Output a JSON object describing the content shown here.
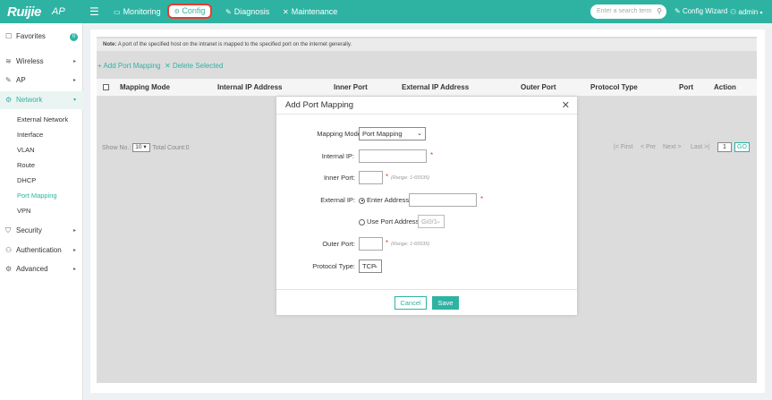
{
  "header": {
    "brand": "Ruijie",
    "product": "AP",
    "nav": [
      {
        "label": "Monitoring",
        "icon": "monitor-icon"
      },
      {
        "label": "Config",
        "icon": "config-icon",
        "active": true
      },
      {
        "label": "Diagnosis",
        "icon": "diagnosis-icon"
      },
      {
        "label": "Maintenance",
        "icon": "maintenance-icon"
      }
    ],
    "search_placeholder": "Enter a search term",
    "wizard": "Config Wizard",
    "user": "admin"
  },
  "sidebar": {
    "favorites": {
      "label": "Favorites",
      "badge": "0"
    },
    "groups": [
      {
        "label": "Wireless"
      },
      {
        "label": "AP"
      },
      {
        "label": "Network",
        "active": true
      },
      {
        "label": "Security"
      },
      {
        "label": "Authentication"
      },
      {
        "label": "Advanced"
      }
    ],
    "network_sub": [
      "External Network",
      "Interface",
      "VLAN",
      "Route",
      "DHCP",
      "Port Mapping",
      "VPN"
    ],
    "active_sub": "Port Mapping"
  },
  "page": {
    "note_prefix": "Note:",
    "note_text": "A port of the specified host on the intranet is mapped to the specified port on the internet generally.",
    "add_label": "Add Port Mapping",
    "delete_label": "Delete Selected",
    "columns": [
      "Mapping Mode",
      "Internal IP Address",
      "Inner Port",
      "External IP Address",
      "Outer Port",
      "Protocol Type",
      "Port",
      "Action"
    ],
    "pager": {
      "show_no": "Show No.:",
      "page_size": "10",
      "total": "Total Count:0",
      "first": "First",
      "prev": "Pre",
      "next": "Next",
      "last": "Last",
      "current_page": "1",
      "go": "GO"
    }
  },
  "modal": {
    "title": "Add Port Mapping",
    "mapping_mode_label": "Mapping Mode:",
    "mapping_mode_value": "Port Mapping",
    "internal_ip_label": "Internal IP:",
    "inner_port_label": "Inner Port:",
    "port_range_hint": "(Range: 1-65535)",
    "external_ip_label": "External IP:",
    "enter_address_label": "Enter Address:",
    "use_port_address_label": "Use Port Address:",
    "port_address_value": "Gi0/1",
    "outer_port_label": "Outer Port:",
    "protocol_label": "Protocol Type:",
    "protocol_value": "TCP",
    "required_mark": "*",
    "cancel": "Cancel",
    "save": "Save"
  },
  "colors": {
    "accent": "#2eb3a3",
    "highlight": "#e53e32"
  }
}
